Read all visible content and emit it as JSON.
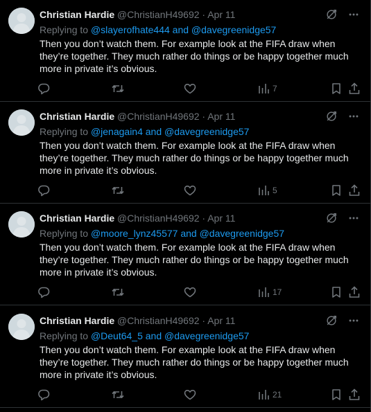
{
  "theme": {
    "background": "#000000",
    "text": "#e7e9ea",
    "muted": "#71767b",
    "link": "#1d9bf0",
    "border": "#2f3336"
  },
  "icons": {
    "avatar": "default-avatar-icon",
    "grok": "grok-icon",
    "more": "more-icon",
    "reply": "reply-icon",
    "retweet": "retweet-icon",
    "like": "like-icon",
    "views": "views-icon",
    "bookmark": "bookmark-icon",
    "share": "share-icon"
  },
  "tweets": [
    {
      "name": "Christian Hardie",
      "handle": "@ChristianH49692",
      "dot": "·",
      "date": "Apr 11",
      "replying_prefix": "Replying to",
      "mention1": "@slayerofhate444",
      "joiner": "and",
      "mention2": "@davegreenidge57",
      "text": "Then you don’t watch them. For example look at the FIFA draw when they’re together. They much rather do things or be happy together much more in private it’s obvious.",
      "views": "7"
    },
    {
      "name": "Christian Hardie",
      "handle": "@ChristianH49692",
      "dot": "·",
      "date": "Apr 11",
      "replying_prefix": "Replying to",
      "mention1": "@jenagain4",
      "joiner": "and",
      "mention2": "@davegreenidge57",
      "text": "Then you don’t watch them. For example look at the FIFA draw when they’re together. They much rather do things or be happy together much more in private it’s obvious.",
      "views": "5"
    },
    {
      "name": "Christian Hardie",
      "handle": "@ChristianH49692",
      "dot": "·",
      "date": "Apr 11",
      "replying_prefix": "Replying to",
      "mention1": "@moore_lynz45577",
      "joiner": "and",
      "mention2": "@davegreenidge57",
      "text": "Then you don’t watch them. For example look at the FIFA draw when they’re together. They much rather do things or be happy together much more in private it’s obvious.",
      "views": "17"
    },
    {
      "name": "Christian Hardie",
      "handle": "@ChristianH49692",
      "dot": "·",
      "date": "Apr 11",
      "replying_prefix": "Replying to",
      "mention1": "@Deut64_5",
      "joiner": "and",
      "mention2": "@davegreenidge57",
      "text": "Then you don’t watch them. For example look at the FIFA draw when they’re together. They much rather do things or be happy together much more in private it’s obvious.",
      "views": "21"
    }
  ]
}
